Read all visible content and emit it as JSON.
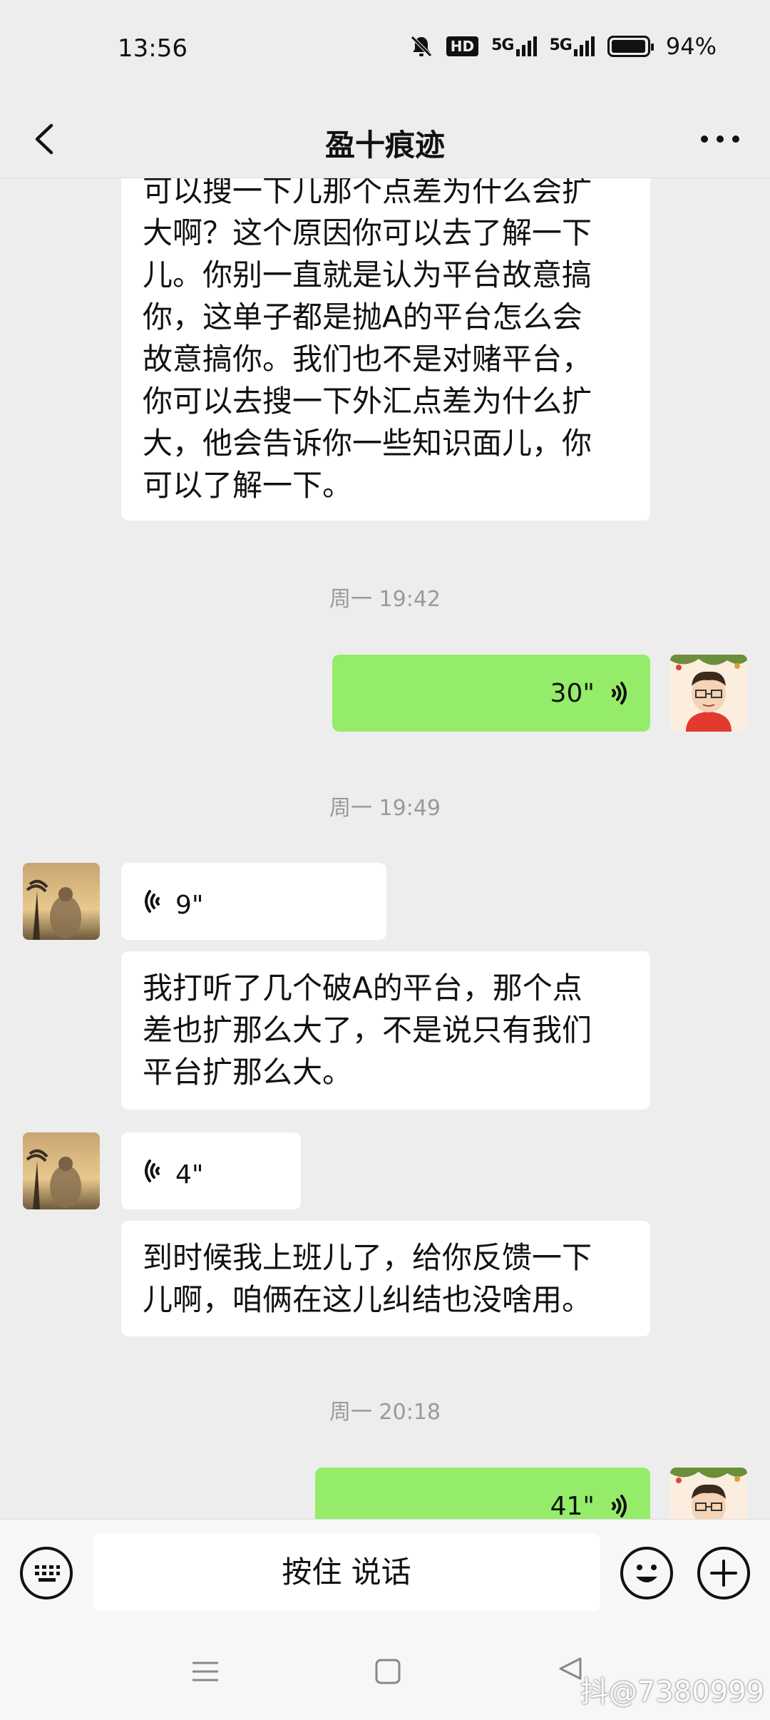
{
  "status_bar": {
    "time": "13:56",
    "hd_label": "HD",
    "sig1_label": "5G",
    "sig2_label": "5G",
    "battery_pct": "94%"
  },
  "header": {
    "title": "盈十痕迹"
  },
  "messages": {
    "m1_lines": [
      "可以搜一下儿那个点差为什么会扩",
      "大啊？这个原因你可以去了解一下",
      "儿。你别一直就是认为平台故意搞",
      "你，这单子都是抛A的平台怎么会",
      "故意搞你。我们也不是对赌平台，",
      "你可以去搜一下外汇点差为什么扩",
      "大，他会告诉你一些知识面儿，你",
      "可以了解一下。"
    ],
    "ts1": "周一 19:42",
    "v1_duration": "30\"",
    "ts2": "周一 19:49",
    "v2_duration": "9\"",
    "m2_lines": [
      "我打听了几个破A的平台，那个点",
      "差也扩那么大了，不是说只有我们",
      "平台扩那么大。"
    ],
    "v3_duration": "4\"",
    "m3_lines": [
      "到时候我上班儿了，给你反馈一下",
      "儿啊，咱俩在这儿纠结也没啥用。"
    ],
    "ts3": "周一 20:18",
    "v4_duration": "41\""
  },
  "input_bar": {
    "talk_label": "按住 说话"
  },
  "watermark": "抖@7380999",
  "colors": {
    "background": "#ededed",
    "my_bubble": "#95ec69",
    "their_bubble": "#ffffff",
    "timestamp": "#9a9a9a"
  },
  "icons": [
    "back-icon",
    "more-icon",
    "voice-wave-icon",
    "keyboard-icon",
    "emoji-icon",
    "add-icon",
    "menu-icon",
    "home-icon",
    "back-triangle-icon",
    "mute-icon",
    "battery-icon"
  ]
}
